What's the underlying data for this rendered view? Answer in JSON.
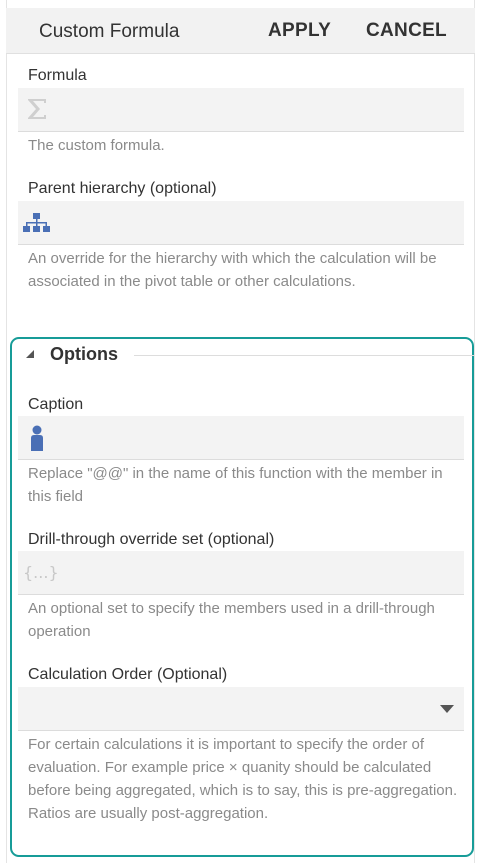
{
  "header": {
    "title": "Custom Formula",
    "apply_label": "APPLY",
    "cancel_label": "CANCEL"
  },
  "formula": {
    "label": "Formula",
    "icon": "sigma-icon",
    "value": "",
    "help": "The custom formula."
  },
  "parent_hierarchy": {
    "label": "Parent hierarchy (optional)",
    "icon": "hierarchy-icon",
    "value": "",
    "help": "An override for the hierarchy with which the calculation will be associated in the pivot table or other calculations."
  },
  "options": {
    "title": "Options",
    "accent_color": "#179c98",
    "caption": {
      "label": "Caption",
      "icon": "member-icon",
      "value": "",
      "help": "Replace \"@@\" in the name of this function with the member in this field"
    },
    "drill_through": {
      "label": "Drill-through override set (optional)",
      "icon": "set-braces-icon",
      "icon_text": "{...}",
      "value": "",
      "help": "An optional set to specify the members used in a drill-through operation"
    },
    "calculation_order": {
      "label": "Calculation Order (Optional)",
      "selected": "",
      "help": "For certain calculations it is important to specify the order of evaluation. For example price × quanity should be calculated before being aggregated, which is to say, this is pre-aggregation. Ratios are usually post-aggregation."
    }
  }
}
